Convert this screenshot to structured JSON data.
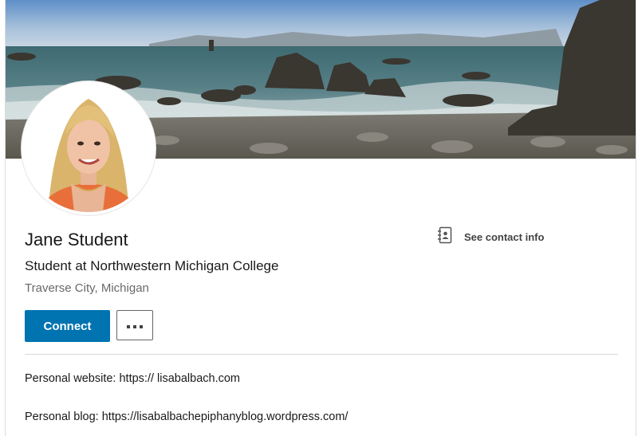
{
  "profile": {
    "name": "Jane Student",
    "headline": "Student at Northwestern Michigan College",
    "location": "Traverse City, Michigan"
  },
  "contact": {
    "label": "See contact info",
    "icon": "contact-book-icon"
  },
  "actions": {
    "connect_label": "Connect",
    "more_icon": "more-horizontal-icon"
  },
  "about": {
    "website_line": "Personal website: https:// lisabalbach.com",
    "blog_line": "Personal blog: https://lisabalbachepiphanyblog.wordpress.com/"
  },
  "colors": {
    "primary": "#0073b1",
    "text_secondary": "#666666"
  }
}
